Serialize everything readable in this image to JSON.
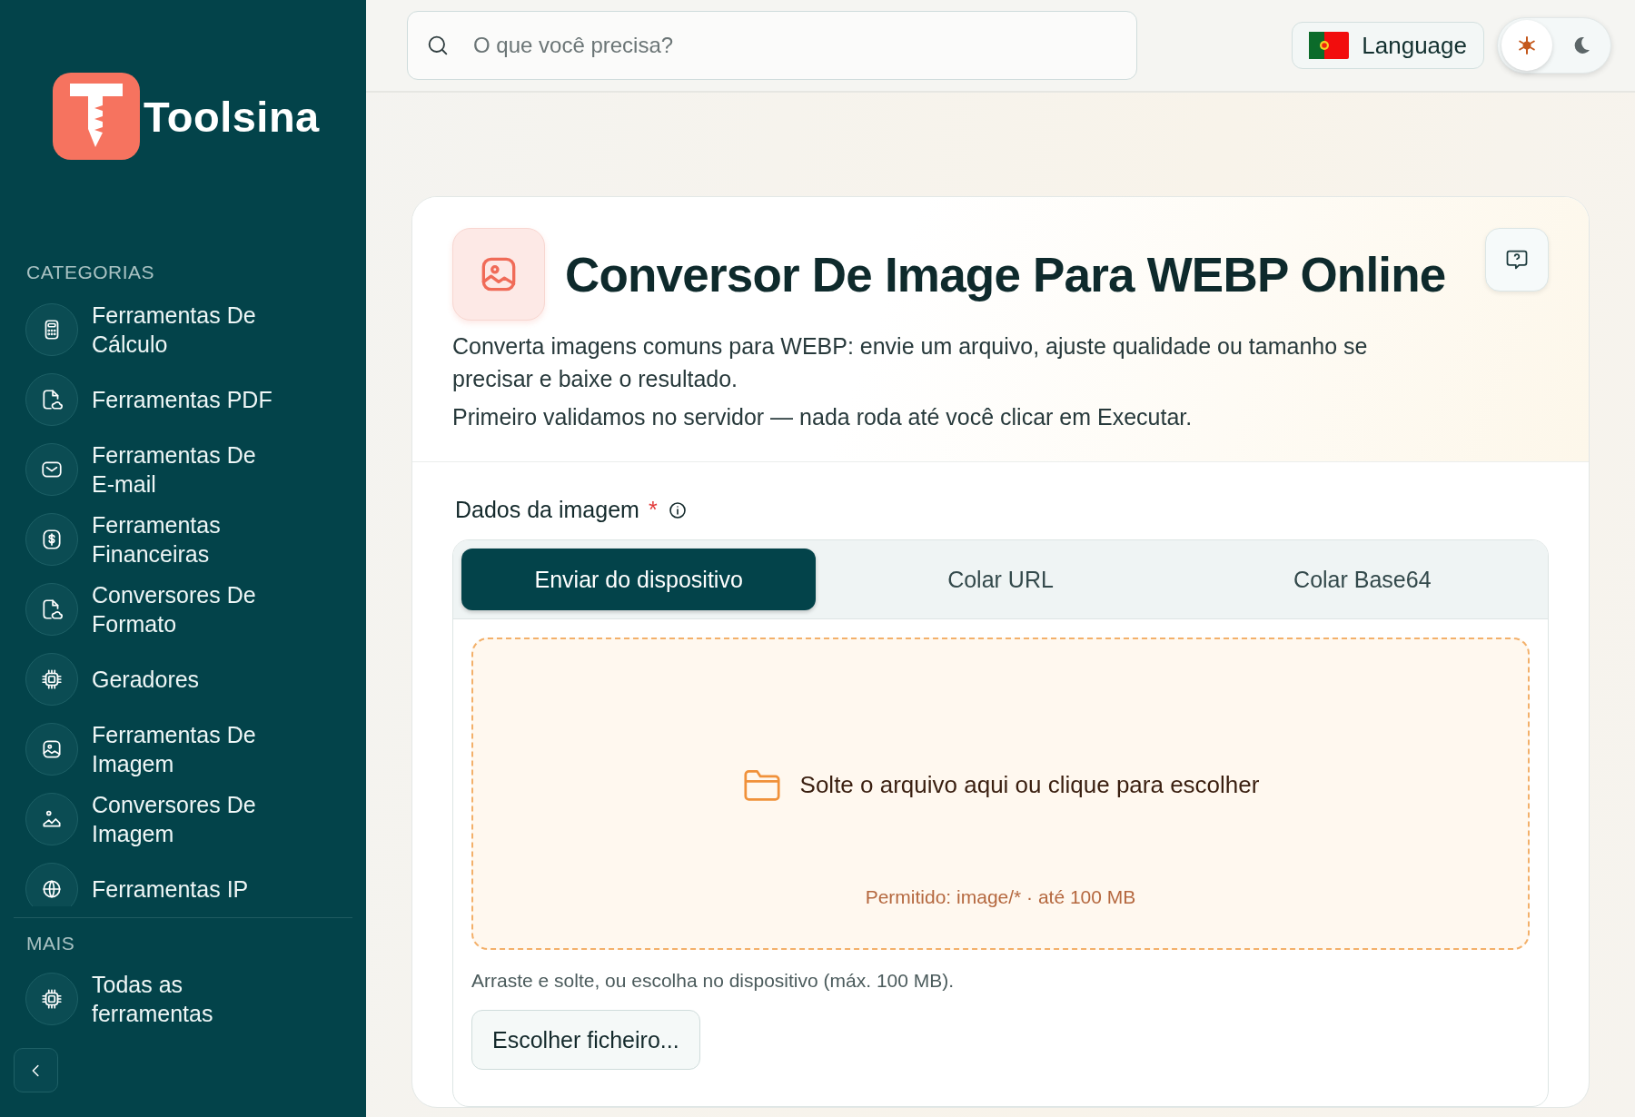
{
  "sidebar": {
    "logo": {
      "name": "Toolsina"
    },
    "sections": [
      {
        "heading": "CATEGORIAS",
        "items": [
          {
            "label": "Ferramentas De Cálculo"
          },
          {
            "label": "Ferramentas PDF"
          },
          {
            "label": "Ferramentas De E-mail"
          },
          {
            "label": "Ferramentas Financeiras"
          },
          {
            "label": "Conversores De Formato"
          },
          {
            "label": "Geradores"
          },
          {
            "label": "Ferramentas De Imagem"
          },
          {
            "label": "Conversores De Imagem"
          },
          {
            "label": "Ferramentas IP"
          }
        ]
      },
      {
        "heading": "MAIS",
        "items": [
          {
            "label": "Todas as ferramentas"
          }
        ]
      }
    ]
  },
  "header": {
    "search": {
      "placeholder": "O que você precisa?"
    },
    "language": {
      "label": "Language"
    },
    "theme": {
      "dark": false
    }
  },
  "tool": {
    "title": "Conversor De Image Para WEBP Online",
    "description": "Converta imagens comuns para WEBP: envie um arquivo, ajuste qualidade ou tamanho se precisar e baixe o resultado.",
    "note": "Primeiro validamos no servidor — nada roda até você clicar em Executar.",
    "field": {
      "label": "Dados da imagem",
      "required_mark": "*"
    },
    "tabs": [
      {
        "label": "Enviar do dispositivo",
        "selected": true
      },
      {
        "label": "Colar URL",
        "selected": false
      },
      {
        "label": "Colar Base64",
        "selected": false
      }
    ],
    "dropzone": {
      "text": "Solte o arquivo aqui ou clique para escolher",
      "allowed": "Permitido: image/* · até 100 MB"
    },
    "hint": "Arraste e solte, ou escolha no dispositivo (máx. 100 MB).",
    "file_button": "Escolher ficheiro..."
  }
}
